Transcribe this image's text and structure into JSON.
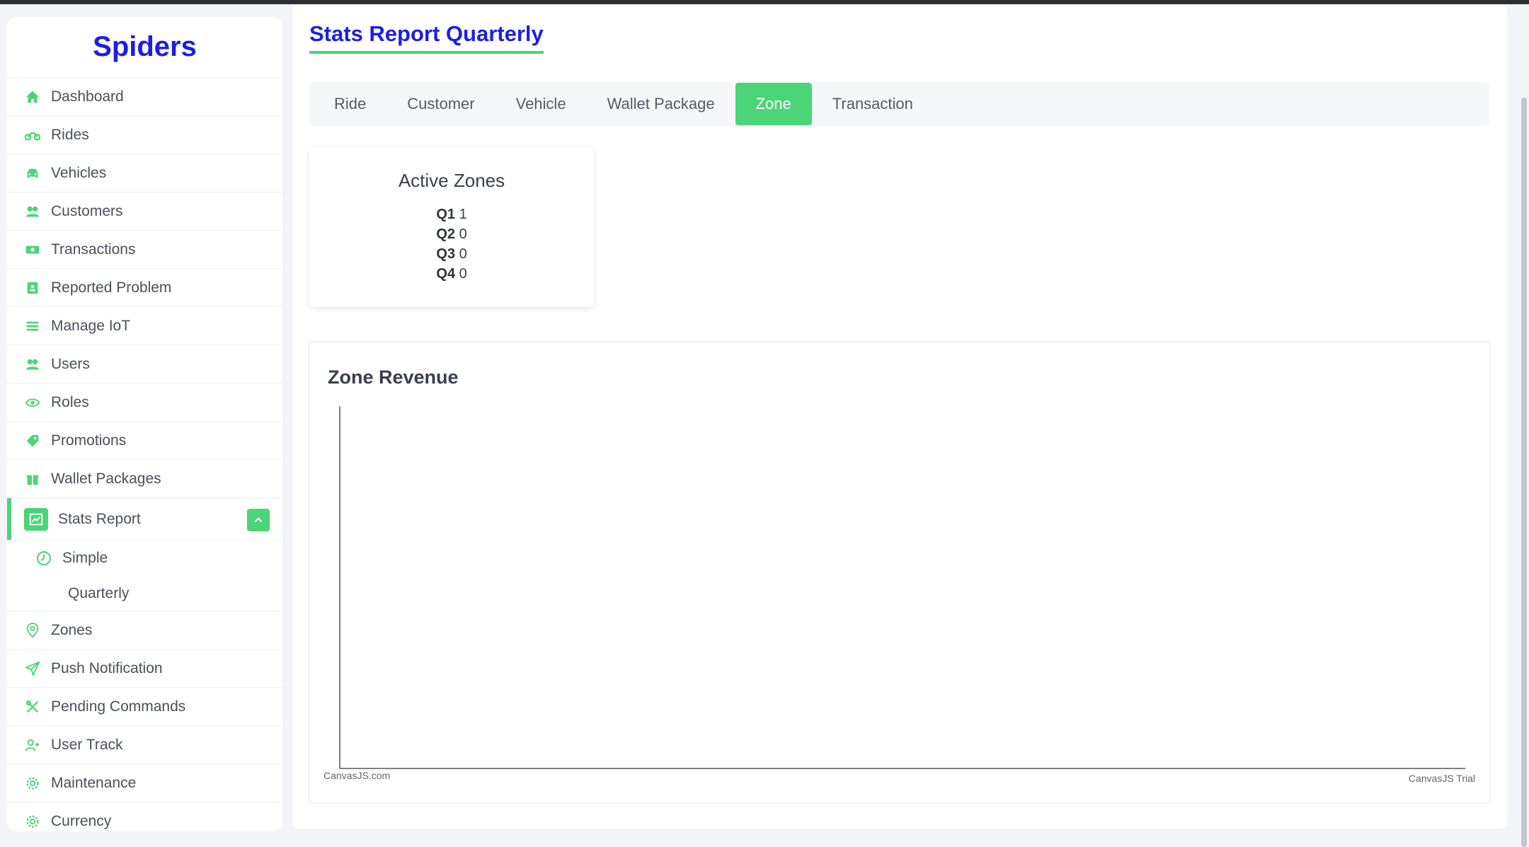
{
  "sidebar": {
    "brand": "Spiders",
    "items": [
      {
        "label": "Dashboard",
        "icon": "home-icon"
      },
      {
        "label": "Rides",
        "icon": "motorcycle-icon"
      },
      {
        "label": "Vehicles",
        "icon": "car-icon"
      },
      {
        "label": "Customers",
        "icon": "users-icon"
      },
      {
        "label": "Transactions",
        "icon": "money-icon"
      },
      {
        "label": "Reported Problem",
        "icon": "report-icon"
      },
      {
        "label": "Manage IoT",
        "icon": "list-icon"
      },
      {
        "label": "Users",
        "icon": "users-icon"
      },
      {
        "label": "Roles",
        "icon": "eye-icon"
      },
      {
        "label": "Promotions",
        "icon": "tag-icon"
      },
      {
        "label": "Wallet Packages",
        "icon": "gift-icon"
      },
      {
        "label": "Stats Report",
        "icon": "chart-line-icon"
      },
      {
        "label": "Simple",
        "icon": "clock-icon"
      },
      {
        "label": "Quarterly",
        "icon": ""
      },
      {
        "label": "Zones",
        "icon": "map-pin-icon"
      },
      {
        "label": "Push Notification",
        "icon": "send-icon"
      },
      {
        "label": "Pending Commands",
        "icon": "tools-icon"
      },
      {
        "label": "User Track",
        "icon": "user-plus-icon"
      },
      {
        "label": "Maintenance",
        "icon": "gear-icon"
      },
      {
        "label": "Currency",
        "icon": "gear-icon"
      }
    ]
  },
  "main": {
    "title": "Stats Report Quarterly",
    "tabs": [
      {
        "label": "Ride"
      },
      {
        "label": "Customer"
      },
      {
        "label": "Vehicle"
      },
      {
        "label": "Wallet Package"
      },
      {
        "label": "Zone"
      },
      {
        "label": "Transaction"
      }
    ],
    "active_tab": "Zone",
    "active_zones": {
      "title": "Active Zones",
      "quarters": [
        {
          "q": "Q1",
          "value": "1"
        },
        {
          "q": "Q2",
          "value": "0"
        },
        {
          "q": "Q3",
          "value": "0"
        },
        {
          "q": "Q4",
          "value": "0"
        }
      ]
    },
    "zone_revenue": {
      "title": "Zone Revenue",
      "credit_left": "CanvasJS.com",
      "credit_right": "CanvasJS Trial"
    }
  },
  "colors": {
    "accent": "#4cd478",
    "brand": "#1c1fe0"
  }
}
